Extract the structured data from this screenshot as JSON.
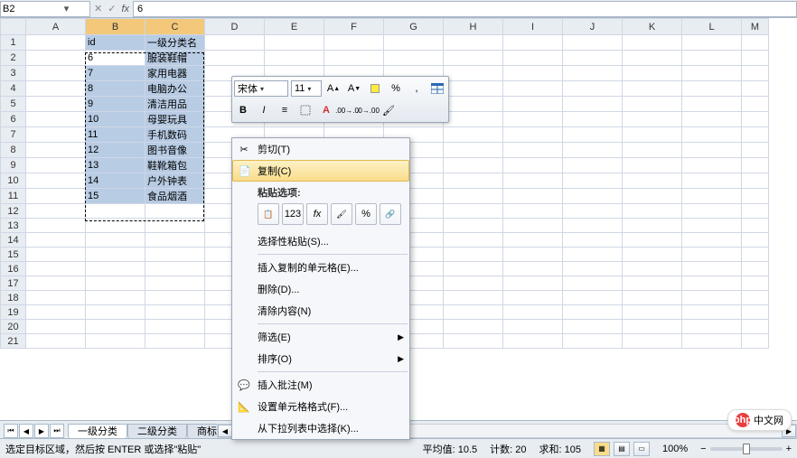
{
  "name_box": "B2",
  "formula_value": "6",
  "columns": [
    "A",
    "B",
    "C",
    "D",
    "E",
    "F",
    "G",
    "H",
    "I",
    "J",
    "K",
    "L",
    "M"
  ],
  "row_count": 21,
  "selected_rows": [
    1,
    2,
    3,
    4,
    5,
    6,
    7,
    8,
    9,
    10,
    11
  ],
  "selected_cols_idx": [
    1,
    2
  ],
  "header_row": {
    "B": "id",
    "C": "一级分类名"
  },
  "data_rows": [
    {
      "B": "6",
      "C": "服装鞋帽"
    },
    {
      "B": "7",
      "C": "家用电器"
    },
    {
      "B": "8",
      "C": "电脑办公"
    },
    {
      "B": "9",
      "C": "清洁用品"
    },
    {
      "B": "10",
      "C": "母婴玩具"
    },
    {
      "B": "11",
      "C": "手机数码"
    },
    {
      "B": "12",
      "C": "图书音像"
    },
    {
      "B": "13",
      "C": "鞋靴箱包"
    },
    {
      "B": "14",
      "C": "户外钟表"
    },
    {
      "B": "15",
      "C": "食品烟酒"
    }
  ],
  "mini_toolbar": {
    "font": "宋体",
    "size": "11",
    "buttons_row1": [
      "A⁺",
      "A⁻",
      "fill-icon",
      "%",
      ",",
      "table-icon"
    ],
    "buttons_row2": [
      "B",
      "I",
      "align",
      "border",
      "A-color",
      "decimal+",
      "decimal-",
      "brush"
    ]
  },
  "context_menu": {
    "cut": "剪切(T)",
    "copy": "复制(C)",
    "paste_header": "粘贴选项:",
    "paste_special": "选择性粘贴(S)...",
    "insert_copied": "插入复制的单元格(E)...",
    "delete": "删除(D)...",
    "clear": "清除内容(N)",
    "filter": "筛选(E)",
    "sort": "排序(O)",
    "comment": "插入批注(M)",
    "format_cells": "设置单元格格式(F)...",
    "pick_list": "从下拉列表中选择(K)..."
  },
  "paste_icons": [
    "paste",
    "123",
    "fx",
    "fmt",
    "%",
    "link"
  ],
  "tabs": [
    "一级分类",
    "二级分类",
    "商标表"
  ],
  "active_tab": 0,
  "status": {
    "msg": "选定目标区域，然后按 ENTER 或选择\"粘贴\"",
    "avg_label": "平均值:",
    "avg": "10.5",
    "count_label": "计数:",
    "count": "20",
    "sum_label": "求和:",
    "sum": "105",
    "zoom": "100%"
  },
  "watermark": "中文网",
  "watermark_prefix": "php"
}
